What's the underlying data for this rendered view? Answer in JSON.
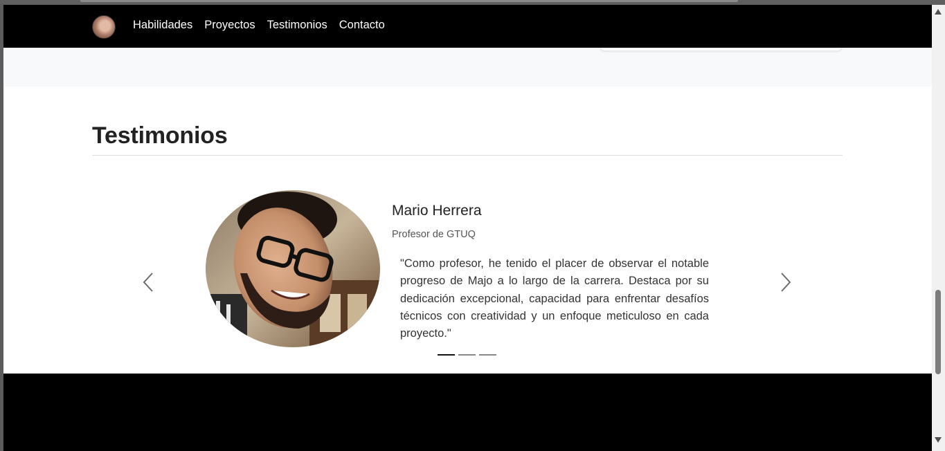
{
  "nav": {
    "links": [
      "Habilidades",
      "Proyectos",
      "Testimonios",
      "Contacto"
    ]
  },
  "testimonials": {
    "title": "Testimonios",
    "active_index": 0,
    "indicator_count": 3,
    "current": {
      "name": "Mario Herrera",
      "role": "Profesor de GTUQ",
      "quote": "\"Como profesor, he tenido el placer de observar el notable progreso de Majo a lo largo de la carrera. Destaca por su dedicación excepcional, capacidad para enfrentar desafíos técnicos con creatividad y un enfoque meticuloso en cada proyecto.\""
    }
  },
  "icons": {
    "prev": "chevron-left-icon",
    "next": "chevron-right-icon"
  },
  "colors": {
    "navbar_bg": "#000000",
    "section_alt_bg": "#f8f9fa",
    "footer_bg": "#000000",
    "indicator_active": "#111111",
    "indicator_inactive": "#888888"
  }
}
